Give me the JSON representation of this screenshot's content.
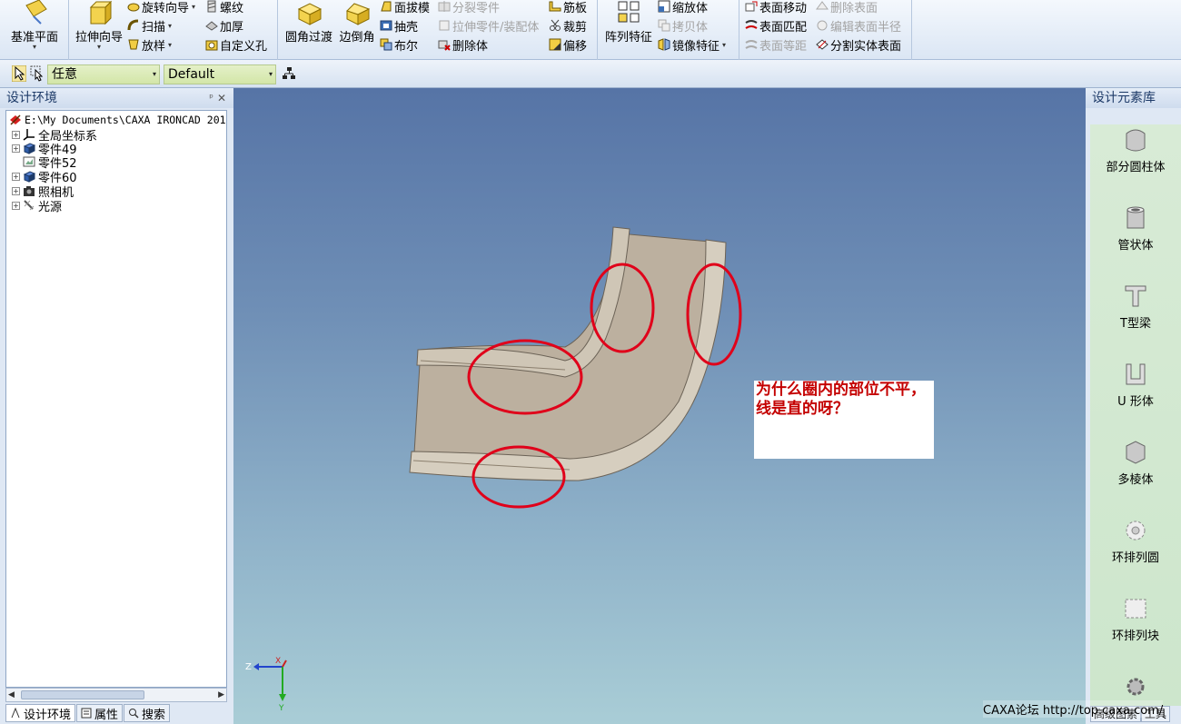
{
  "ribbon": {
    "g1": {
      "baseplane": "基准平面"
    },
    "g2": {
      "extrude_wizard": "拉伸向导",
      "revolve_wizard": "旋转向导",
      "sweep": "扫描",
      "loft": "放样",
      "thread": "螺纹",
      "thicken": "加厚",
      "custom_hole": "自定义孔"
    },
    "g3": {
      "fillet": "圆角过渡",
      "chamfer": "边倒角",
      "face_draft": "面拔模",
      "shell": "抽壳",
      "boolean": "布尔",
      "split_part": "分裂零件",
      "extrude_part": "拉伸零件/装配体",
      "delete_body": "删除体",
      "rib": "筋板",
      "trim": "裁剪",
      "offset": "偏移"
    },
    "g4": {
      "array_feature": "阵列特征",
      "scale_body": "缩放体",
      "copy_body": "拷贝体",
      "mirror_feature": "镜像特征"
    },
    "g5": {
      "face_move": "表面移动",
      "delete_face": "删除表面",
      "face_match": "表面匹配",
      "edit_face_radius": "编辑表面半径",
      "face_offset": "表面等距",
      "split_solid_face": "分割实体表面"
    }
  },
  "toolbar2": {
    "filter_value": "任意",
    "style_value": "Default"
  },
  "left_panel": {
    "title": "设计环境",
    "tree": [
      {
        "label": "E:\\My Documents\\CAXA IRONCAD 201",
        "expander": ""
      },
      {
        "label": "全局坐标系",
        "expander": "+"
      },
      {
        "label": "零件49",
        "expander": "+"
      },
      {
        "label": "零件52",
        "expander": ""
      },
      {
        "label": "零件60",
        "expander": "+"
      },
      {
        "label": "照相机",
        "expander": "+"
      },
      {
        "label": "光源",
        "expander": "+"
      }
    ],
    "tabs": [
      "设计环境",
      "属性",
      "搜索"
    ]
  },
  "viewport": {
    "annotation": "为什么圈内的部位不平，线是直的呀？",
    "axis_labels": {
      "x": "X",
      "y": "Y",
      "z": "Z"
    },
    "highlight_color": "#e0001a"
  },
  "right_panel": {
    "title": "设计元素库",
    "shapes": [
      "部分圆柱体",
      "管状体",
      "T型梁",
      "U 形体",
      "多棱体",
      "环排列圆",
      "环排列块"
    ],
    "tabs": [
      "高级图素",
      "工具"
    ]
  },
  "watermark": "CAXA论坛 http://top.caxa.com/"
}
